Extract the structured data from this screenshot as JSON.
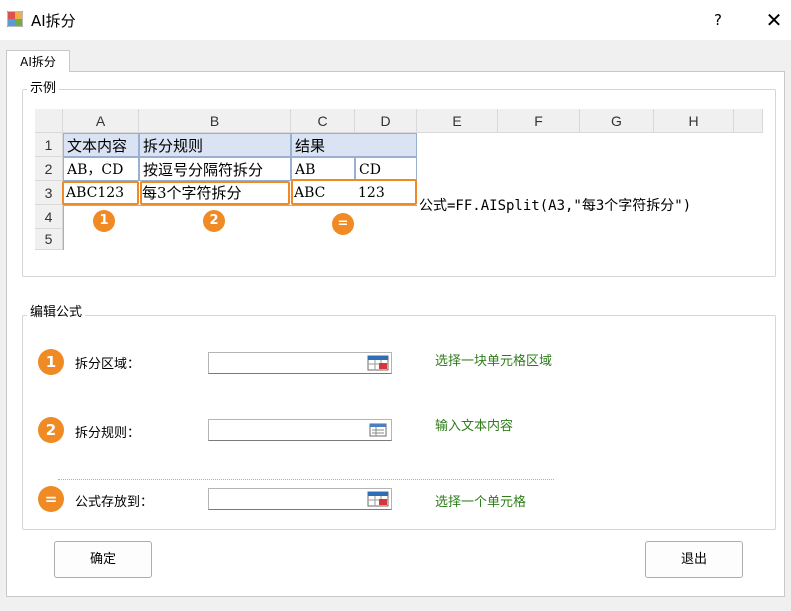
{
  "window": {
    "title": "AI拆分",
    "help": "?",
    "close": "✕"
  },
  "tab": {
    "label": "AI拆分"
  },
  "example": {
    "title": "示例",
    "columns": [
      "A",
      "B",
      "C",
      "D",
      "E",
      "F",
      "G",
      "H"
    ],
    "rows": [
      "1",
      "2",
      "3",
      "4",
      "5"
    ],
    "cells": {
      "a1": "文本内容",
      "b1": "拆分规则",
      "c1": "结果",
      "a2": "AB，CD",
      "b2": "按逗号分隔符拆分",
      "c2": "AB",
      "d2": "CD",
      "a3": "ABC123",
      "b3": "每3个字符拆分",
      "c3": "ABC",
      "d3": "123"
    },
    "badges": [
      "1",
      "2",
      "="
    ],
    "formula": "公式=FF.AISplit(A3,\"每3个字符拆分\")"
  },
  "edit": {
    "title": "编辑公式",
    "fields": [
      {
        "badge": "1",
        "label": "拆分区域：",
        "hint": "选择一块单元格区域",
        "value": ""
      },
      {
        "badge": "2",
        "label": "拆分规则：",
        "hint": "输入文本内容",
        "value": ""
      },
      {
        "badge": "=",
        "label": "公式存放到：",
        "hint": "选择一个单元格",
        "value": ""
      }
    ]
  },
  "buttons": {
    "ok": "确定",
    "exit": "退出"
  },
  "colors": {
    "accent": "#f08a24",
    "hint": "#2e7d1a",
    "header_fill": "#dae3f3"
  }
}
